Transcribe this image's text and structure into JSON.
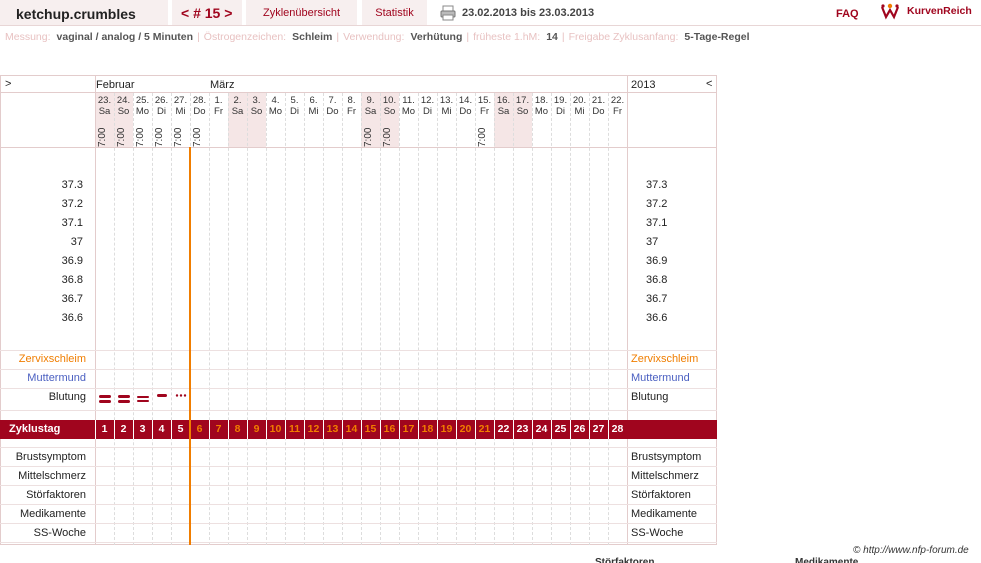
{
  "header": {
    "username": "ketchup.crumbles",
    "cycle_nav": "< # 15 >",
    "tab_overview": "Zyklenübersicht",
    "tab_stats": "Statistik",
    "date_range": "23.02.2013 bis 23.03.2013",
    "faq": "FAQ",
    "logo_text": "KurvenReich"
  },
  "settings": [
    {
      "key": "Messung:",
      "value": "vaginal / analog / 5 Minuten"
    },
    {
      "key": "Östrogenzeichen:",
      "value": "Schleim"
    },
    {
      "key": "Verwendung:",
      "value": "Verhütung"
    },
    {
      "key": "früheste 1.hM:",
      "value": "14"
    },
    {
      "key": "Freigabe Zyklusanfang:",
      "value": "5-Tage-Regel"
    }
  ],
  "chart": {
    "left_arrow": ">",
    "right_arrow": "<",
    "month_feb": "Februar",
    "month_mar": "März",
    "year": "2013",
    "days": [
      {
        "d": "23.",
        "w": "Sa",
        "t": "7:00",
        "we": true
      },
      {
        "d": "24.",
        "w": "So",
        "t": "7:00",
        "we": true
      },
      {
        "d": "25.",
        "w": "Mo",
        "t": "7:00"
      },
      {
        "d": "26.",
        "w": "Di",
        "t": "7:00"
      },
      {
        "d": "27.",
        "w": "Mi",
        "t": "7:00"
      },
      {
        "d": "28.",
        "w": "Do",
        "t": "7:00"
      },
      {
        "d": "1.",
        "w": "Fr",
        "t": ""
      },
      {
        "d": "2.",
        "w": "Sa",
        "t": "",
        "we": true
      },
      {
        "d": "3.",
        "w": "So",
        "t": "",
        "we": true
      },
      {
        "d": "4.",
        "w": "Mo",
        "t": ""
      },
      {
        "d": "5.",
        "w": "Di",
        "t": ""
      },
      {
        "d": "6.",
        "w": "Mi",
        "t": ""
      },
      {
        "d": "7.",
        "w": "Do",
        "t": ""
      },
      {
        "d": "8.",
        "w": "Fr",
        "t": ""
      },
      {
        "d": "9.",
        "w": "Sa",
        "t": "7:00",
        "we": true
      },
      {
        "d": "10.",
        "w": "So",
        "t": "7:00",
        "we": true
      },
      {
        "d": "11.",
        "w": "Mo",
        "t": ""
      },
      {
        "d": "12.",
        "w": "Di",
        "t": ""
      },
      {
        "d": "13.",
        "w": "Mi",
        "t": ""
      },
      {
        "d": "14.",
        "w": "Do",
        "t": ""
      },
      {
        "d": "15.",
        "w": "Fr",
        "t": "7:00"
      },
      {
        "d": "16.",
        "w": "Sa",
        "t": "",
        "we": true
      },
      {
        "d": "17.",
        "w": "So",
        "t": "",
        "we": true
      },
      {
        "d": "18.",
        "w": "Mo",
        "t": ""
      },
      {
        "d": "19.",
        "w": "Di",
        "t": ""
      },
      {
        "d": "20.",
        "w": "Mi",
        "t": ""
      },
      {
        "d": "21.",
        "w": "Do",
        "t": ""
      },
      {
        "d": "22.",
        "w": "Fr",
        "t": ""
      }
    ],
    "temps": [
      "37.3",
      "37.2",
      "37.1",
      "37",
      "36.9",
      "36.8",
      "36.7",
      "36.6"
    ],
    "rows": {
      "zervix": "Zervixschleim",
      "muttermund": "Muttermund",
      "blutung": "Blutung",
      "zyklustag": "Zyklustag",
      "brust": "Brustsymptom",
      "mittel": "Mittelschmerz",
      "stoer": "Störfaktoren",
      "medi": "Medikamente",
      "ss": "SS-Woche"
    },
    "bleeding": [
      "heavy",
      "heavy",
      "medium",
      "light",
      "spotting"
    ],
    "cycle_days": [
      "1",
      "2",
      "3",
      "4",
      "5",
      "6",
      "7",
      "8",
      "9",
      "10",
      "11",
      "12",
      "13",
      "14",
      "15",
      "16",
      "17",
      "18",
      "19",
      "20",
      "21",
      "22",
      "23",
      "24",
      "25",
      "26",
      "27",
      "28"
    ],
    "infertile_until_day": 5
  },
  "colors": {
    "accent": "#a0051e",
    "orange": "#f07d00",
    "blue": "#4a5fc1",
    "weekend": "#f5e6e6"
  },
  "footer": {
    "copyright": "© http://www.nfp-forum.de",
    "cut_stoer": "Störfaktoren",
    "cut_medi": "Medikamente"
  }
}
